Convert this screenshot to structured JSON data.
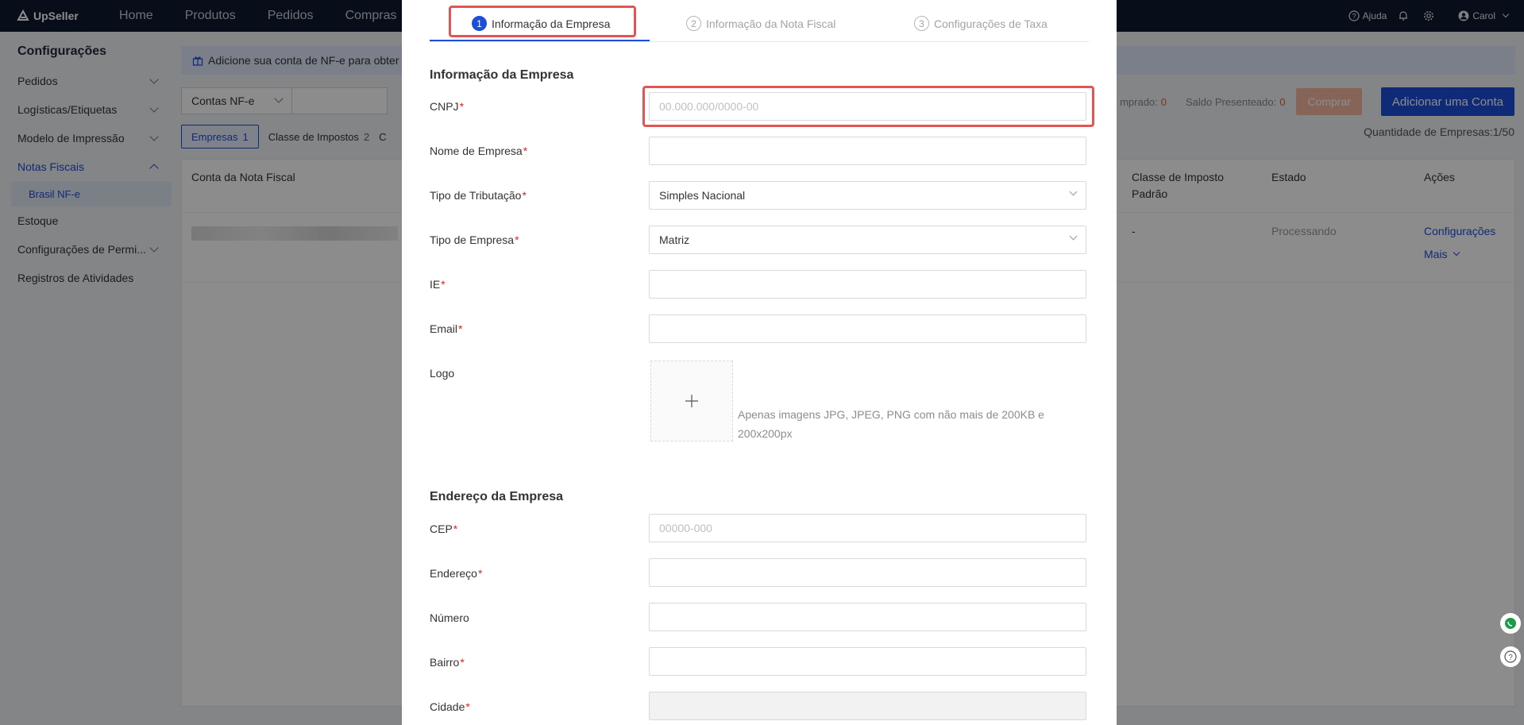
{
  "nav": {
    "brand": "UpSeller",
    "links": [
      "Home",
      "Produtos",
      "Pedidos",
      "Compras"
    ],
    "help": "Ajuda",
    "user": "Carol"
  },
  "sidebar": {
    "title": "Configurações",
    "items": [
      {
        "label": "Pedidos"
      },
      {
        "label": "Logísticas/Etiquetas"
      },
      {
        "label": "Modelo de Impressão"
      },
      {
        "label": "Notas Fiscais"
      },
      {
        "label": "Brasil NF-e"
      },
      {
        "label": "Estoque"
      },
      {
        "label": "Configurações de Permi..."
      },
      {
        "label": "Registros de Atividades"
      }
    ]
  },
  "main": {
    "banner": "Adicione sua conta de NF-e para obter",
    "account_select": "Contas NF-e",
    "tabs": [
      {
        "label": "Empresas",
        "count": "1"
      },
      {
        "label": "Classe de Impostos",
        "count": "2"
      },
      {
        "label": "C"
      }
    ],
    "stats": {
      "comprado_label": "mprado:",
      "comprado_value": "0",
      "presenteado_label": "Saldo Presenteado:",
      "presenteado_value": "0"
    },
    "buy_button": "Comprar",
    "add_button": "Adicionar uma Conta",
    "quantity": "Quantidade de Empresas:1/50",
    "table": {
      "col_account": "Conta da Nota Fiscal",
      "col_tax_class": "Classe de Imposto Padrão",
      "col_state": "Estado",
      "col_actions": "Ações",
      "row": {
        "tax_class": "-",
        "state": "Processando",
        "action_config": "Configurações",
        "action_more": "Mais"
      }
    }
  },
  "modal": {
    "steps": [
      {
        "num": "1",
        "label": "Informação da Empresa"
      },
      {
        "num": "2",
        "label": "Informação da Nota Fiscal"
      },
      {
        "num": "3",
        "label": "Configurações de Taxa"
      }
    ],
    "section_company": "Informação da Empresa",
    "fields": {
      "cnpj": {
        "label": "CNPJ",
        "placeholder": "00.000.000/0000-00"
      },
      "company_name": {
        "label": "Nome de Empresa",
        "value": ""
      },
      "tax_type": {
        "label": "Tipo de Tributação",
        "value": "Simples Nacional"
      },
      "company_type": {
        "label": "Tipo de Empresa",
        "value": "Matriz"
      },
      "ie": {
        "label": "IE",
        "value": ""
      },
      "email": {
        "label": "Email",
        "value": ""
      },
      "logo": {
        "label": "Logo",
        "hint": "Apenas imagens JPG, JPEG, PNG com não mais de 200KB e 200x200px"
      }
    },
    "section_address": "Endereço da Empresa",
    "address_fields": {
      "cep": {
        "label": "CEP",
        "placeholder": "00000-000"
      },
      "address": {
        "label": "Endereço",
        "value": ""
      },
      "number": {
        "label": "Número",
        "value": ""
      },
      "district": {
        "label": "Bairro",
        "value": ""
      },
      "city": {
        "label": "Cidade",
        "value": ""
      }
    },
    "required_mark": "*"
  },
  "colors": {
    "primary": "#1d4ed8",
    "highlight": "#e25555",
    "nav_bg": "#0e1b2e"
  }
}
